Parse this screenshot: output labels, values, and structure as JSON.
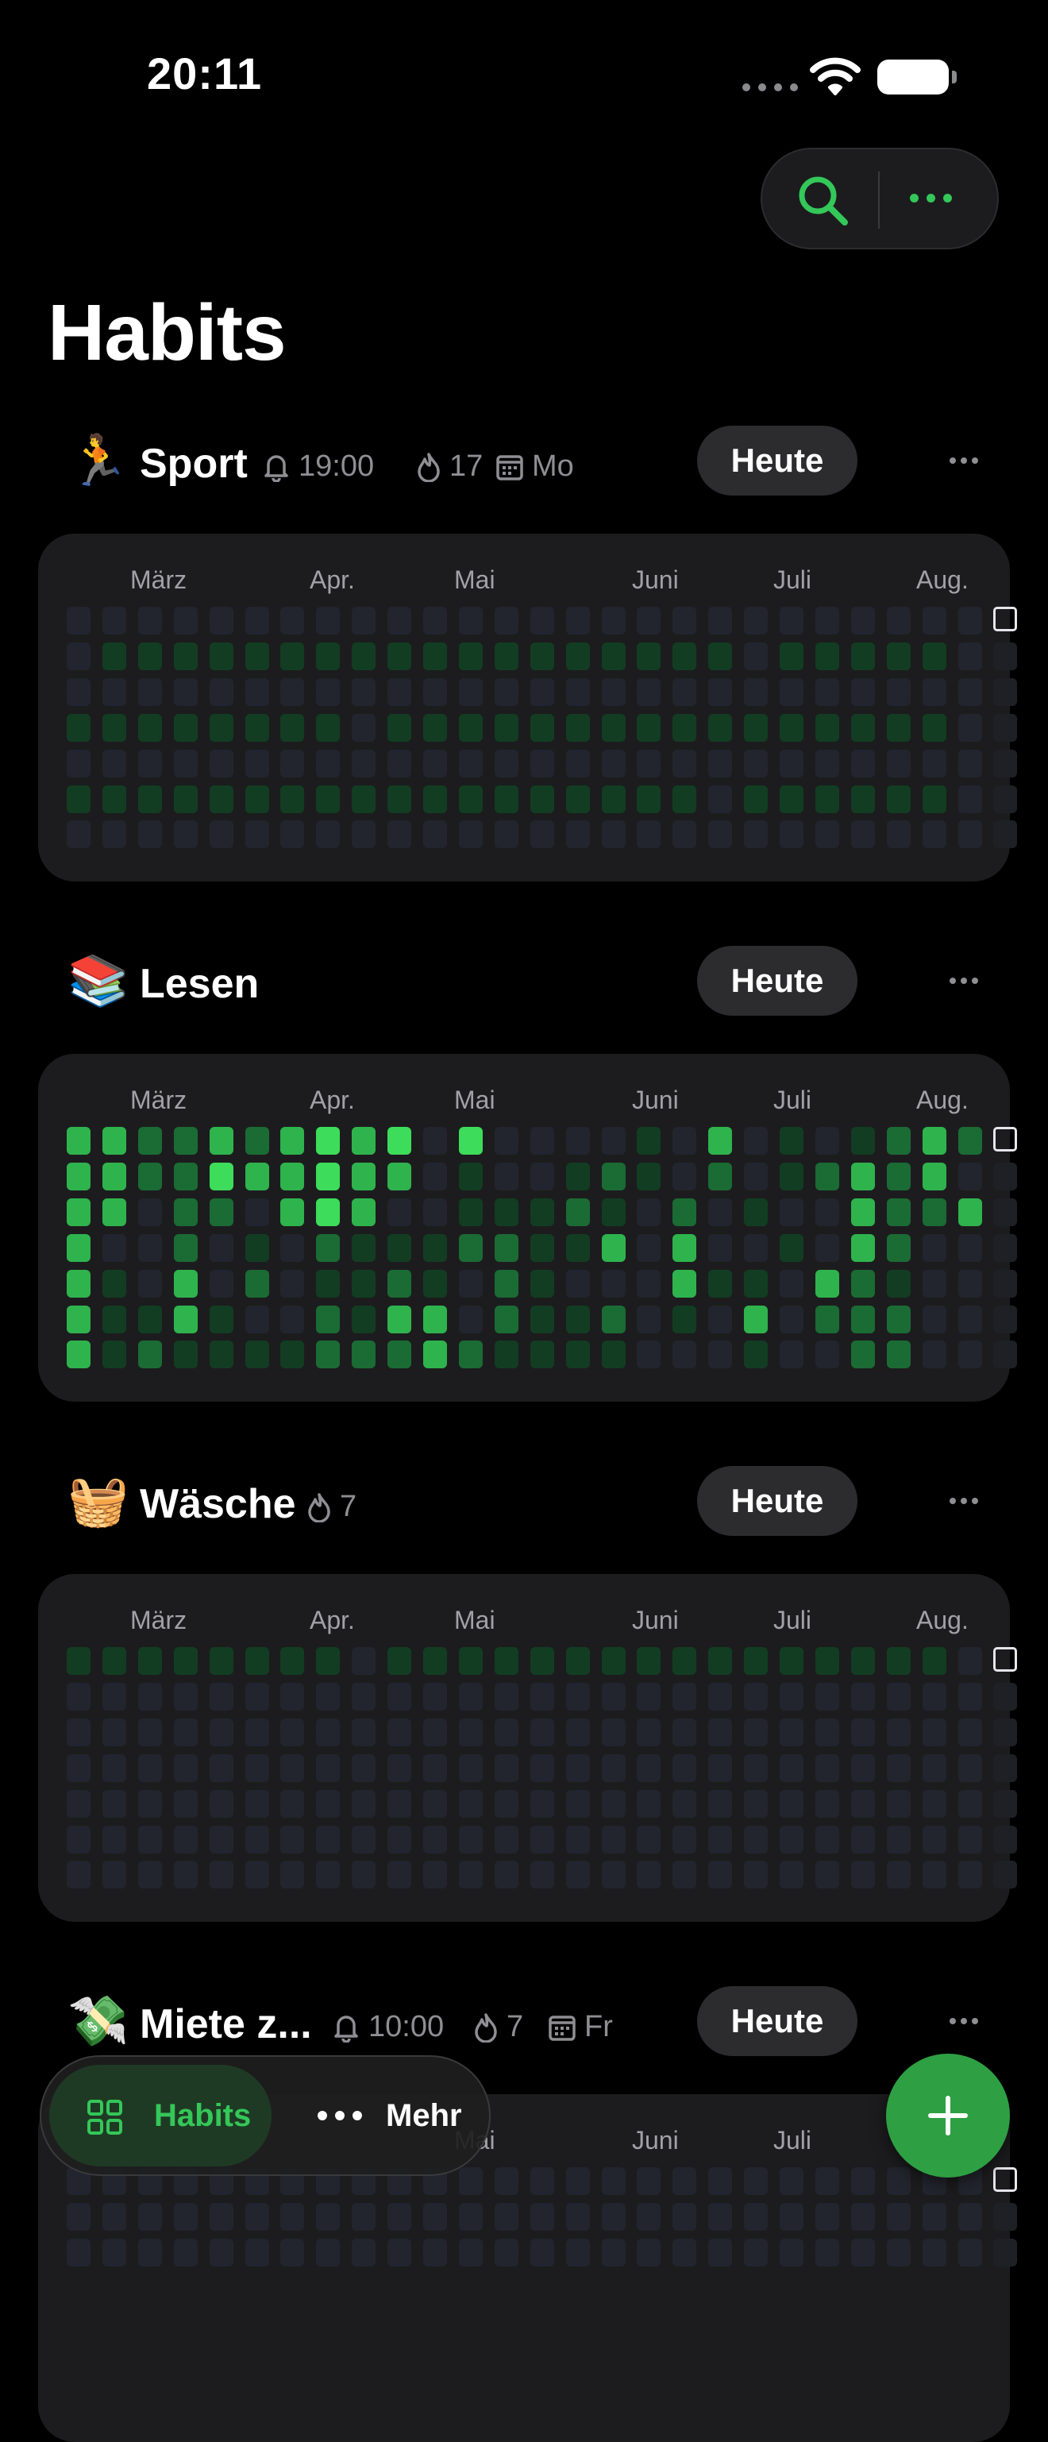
{
  "status_bar": {
    "time": "20:11"
  },
  "page": {
    "title": "Habits"
  },
  "colors": {
    "accent": "#34c759",
    "empty": "#22252d",
    "l1": "#123d22",
    "l2": "#1b6b34",
    "l3": "#2fb34d",
    "l4": "#3ddc5a"
  },
  "habits": [
    {
      "emoji": "🏃",
      "name": "Sport",
      "meta": [
        {
          "icon": "bell-icon",
          "text": "19:00"
        },
        {
          "icon": "flame-icon",
          "text": "17"
        },
        {
          "icon": "calendar-icon",
          "text": "Mo"
        }
      ],
      "today_label": "Heute",
      "months": [
        "März",
        "Apr.",
        "Mai",
        "Juni",
        "Juli",
        "Aug."
      ],
      "grid": [
        "00000000000000000000000000",
        "01111111111111111110111110",
        "00000000000000000000000000",
        "11111111011111111111111110",
        "00000000000000000000000000",
        "11111111111111111101111110",
        "00000000000000000000000000"
      ]
    },
    {
      "emoji": "📚",
      "name": "Lesen",
      "meta": [],
      "today_label": "Heute",
      "months": [
        "März",
        "Apr.",
        "Mai",
        "Juni",
        "Juli",
        "Aug."
      ],
      "grid": [
        "33223234340400001030101232",
        "33224334330100121020123230",
        "33022034300111210201003223",
        "30020102111221130300103200",
        "31030201121021000311032100",
        "31131002133021120103022200",
        "31211112223211110001002200"
      ]
    },
    {
      "emoji": "🧺",
      "name": "Wäsche",
      "meta": [
        {
          "icon": "flame-icon",
          "text": "7"
        }
      ],
      "today_label": "Heute",
      "months": [
        "März",
        "Apr.",
        "Mai",
        "Juni",
        "Juli",
        "Aug."
      ],
      "grid": [
        "11111111011111111111111110",
        "00000000000000000000000000",
        "00000000000000000000000000",
        "00000000000000000000000000",
        "00000000000000000000000000",
        "00000000000000000000000000",
        "00000000000000000000000000"
      ]
    },
    {
      "emoji": "💸",
      "name": "Miete z...",
      "meta": [
        {
          "icon": "bell-icon",
          "text": "10:00"
        },
        {
          "icon": "flame-icon",
          "text": "7"
        },
        {
          "icon": "calendar-icon",
          "text": "Fr"
        }
      ],
      "today_label": "Heute",
      "months": [
        "Mai",
        "Juni",
        "Juli"
      ],
      "grid": [
        "00000000000000000000000000",
        "00000000000000000000000000",
        "00000000000000000000000000"
      ]
    }
  ],
  "tabbar": {
    "tabs": [
      {
        "label": "Habits",
        "icon": "grid-icon",
        "active": true
      },
      {
        "label": "Mehr",
        "icon": "more-dots-icon",
        "active": false
      }
    ]
  },
  "fab": {
    "icon": "plus-icon"
  }
}
